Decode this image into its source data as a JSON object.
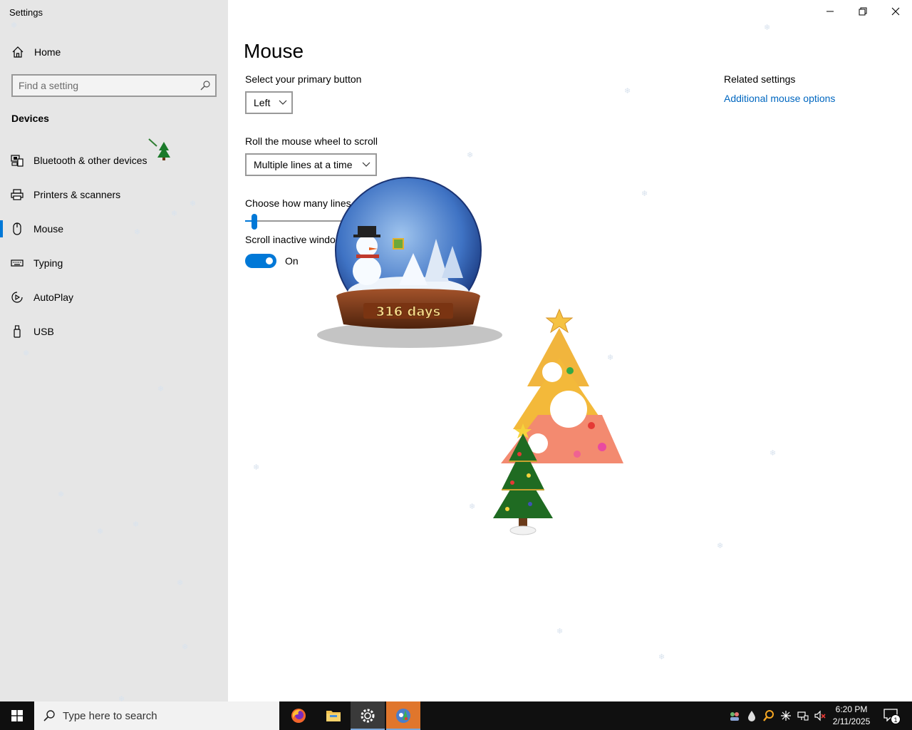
{
  "window": {
    "title": "Settings",
    "controls": {
      "minimize": "minimize-icon",
      "restore": "restore-icon",
      "close": "close-icon"
    }
  },
  "nav": {
    "home": {
      "label": "Home",
      "icon": "home-icon"
    },
    "search": {
      "placeholder": "Find a setting",
      "value": "",
      "icon": "search-icon"
    },
    "section_title": "Devices",
    "items": [
      {
        "label": "Bluetooth & other devices",
        "icon": "bluetooth-devices-icon",
        "selected": false
      },
      {
        "label": "Printers & scanners",
        "icon": "printer-icon",
        "selected": false
      },
      {
        "label": "Mouse",
        "icon": "mouse-icon",
        "selected": true
      },
      {
        "label": "Typing",
        "icon": "keyboard-icon",
        "selected": false
      },
      {
        "label": "AutoPlay",
        "icon": "autoplay-icon",
        "selected": false
      },
      {
        "label": "USB",
        "icon": "usb-icon",
        "selected": false
      }
    ]
  },
  "main": {
    "title": "Mouse",
    "primary_button": {
      "label": "Select your primary button",
      "value": "Left"
    },
    "scroll_wheel": {
      "label": "Roll the mouse wheel to scroll",
      "value": "Multiple lines at a time"
    },
    "lines_to_scroll": {
      "label": "Choose how many lines t",
      "value_fraction": 0.03
    },
    "scroll_inactive": {
      "label": "Scroll inactive windo",
      "state_label": "On",
      "on": true
    }
  },
  "related": {
    "title": "Related settings",
    "link": "Additional mouse options"
  },
  "overlay": {
    "globe_text": "316 days"
  },
  "taskbar": {
    "search_placeholder": "Type here to search",
    "apps": [
      "firefox-icon",
      "file-explorer-icon",
      "settings-icon",
      "christmas-app-icon"
    ],
    "tray_icons": [
      "people-icon",
      "drop-icon",
      "magnifier-icon",
      "sparkle-icon",
      "network-icon",
      "volume-muted-icon"
    ],
    "time": "6:20 PM",
    "date": "2/11/2025",
    "notification_count": "1"
  },
  "colors": {
    "accent": "#0078d7",
    "link": "#0067c0",
    "nav_background": "#e6e6e6",
    "taskbar": "#101010"
  }
}
